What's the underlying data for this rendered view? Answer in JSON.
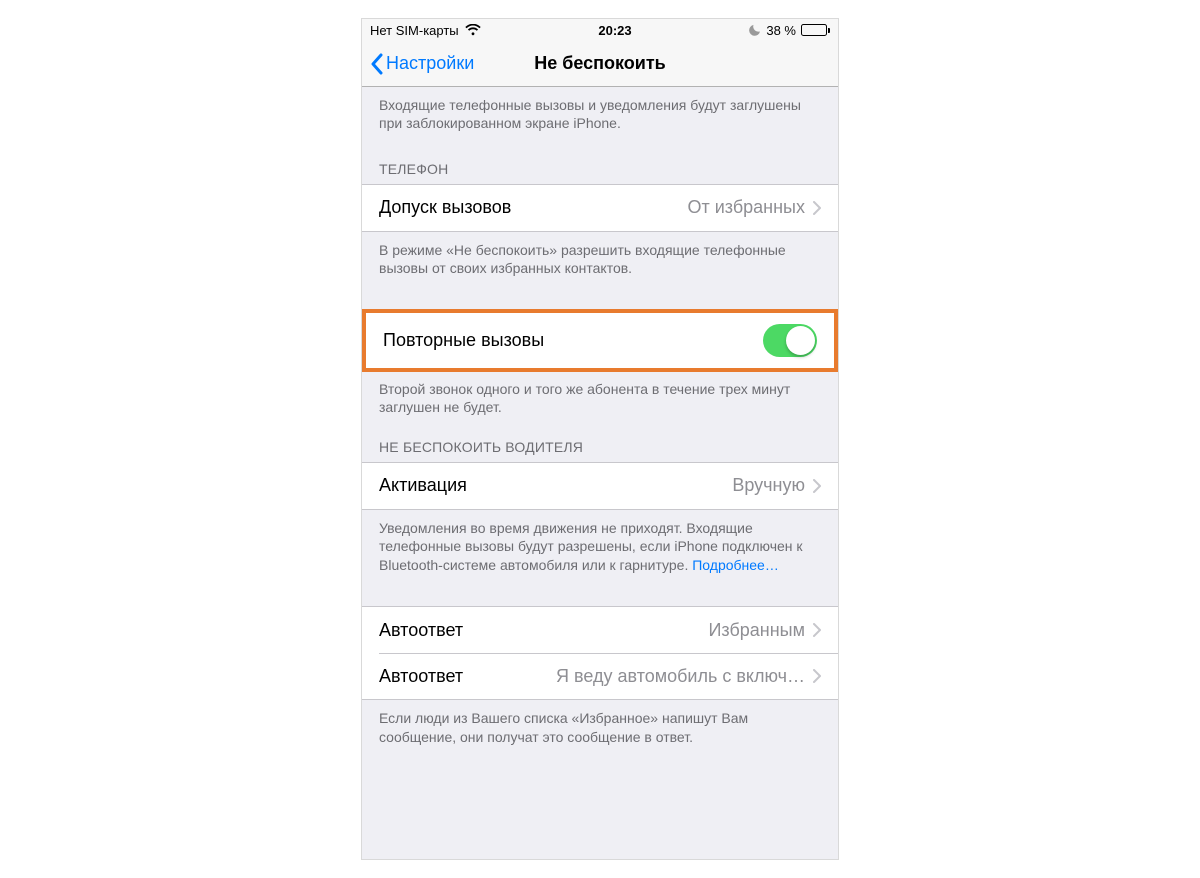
{
  "status": {
    "carrier": "Нет SIM-карты",
    "time": "20:23",
    "battery_text": "38 %"
  },
  "nav": {
    "back_label": "Настройки",
    "title": "Не беспокоить"
  },
  "intro_note": "Входящие телефонные вызовы и уведомления будут заглушены при заблокированном экране iPhone.",
  "phone_section": {
    "header": "ТЕЛЕФОН",
    "allow_calls_label": "Допуск вызовов",
    "allow_calls_value": "От избранных",
    "allow_calls_note": "В режиме «Не беспокоить» разрешить входящие телефонные вызовы от своих избранных контактов.",
    "repeated_label": "Повторные вызовы",
    "repeated_note": "Второй звонок одного и того же абонента в течение трех минут заглушен не будет."
  },
  "drive_section": {
    "header": "НЕ БЕСПОКОИТЬ ВОДИТЕЛЯ",
    "activate_label": "Активация",
    "activate_value": "Вручную",
    "activate_note_prefix": "Уведомления во время движения не приходят. Входящие телефонные вызовы будут разрешены, если iPhone подключен к Bluetooth-системе автомобиля или к гарнитуре. ",
    "activate_note_link": "Подробнее…"
  },
  "autoreply": {
    "row1_label": "Автоответ",
    "row1_value": "Избранным",
    "row2_label": "Автоответ",
    "row2_value": "Я веду автомобиль с включ…",
    "note": "Если люди из Вашего списка «Избранное» напишут Вам сообщение, они получат это сообщение в ответ."
  }
}
